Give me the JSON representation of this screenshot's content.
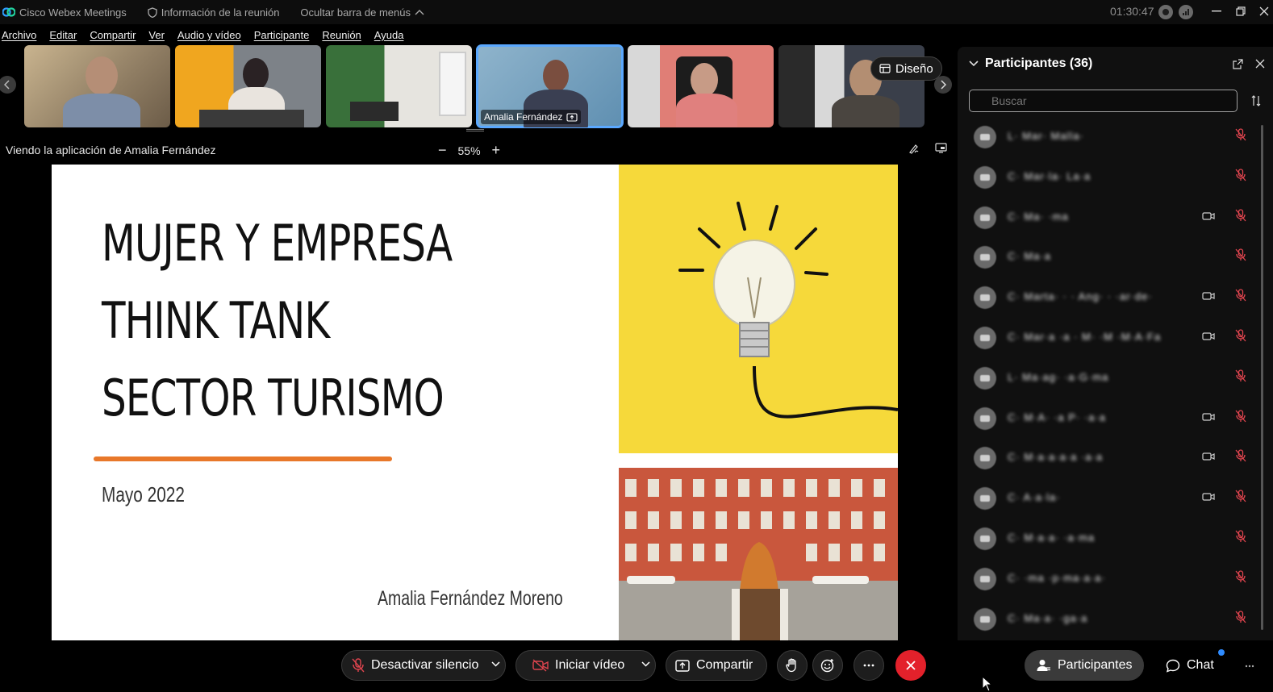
{
  "titlebar": {
    "app_name": "Cisco Webex Meetings",
    "meeting_info": "Información de la reunión",
    "hide_menu": "Ocultar barra de menús",
    "clock": "01:30:47"
  },
  "menu": [
    "Archivo",
    "Editar",
    "Compartir",
    "Ver",
    "Audio y vídeo",
    "Participante",
    "Reunión",
    "Ayuda"
  ],
  "strip": {
    "active_name": "Amalia Fernández",
    "layout_label": "Diseño"
  },
  "share": {
    "viewing": "Viendo la aplicación de Amalia Fernández",
    "zoom": "55%"
  },
  "slide": {
    "title_lines": [
      "MUJER Y EMPRESA",
      "THINK TANK",
      "SECTOR TURISMO"
    ],
    "date": "Mayo 2022",
    "author": "Amalia Fernández Moreno"
  },
  "panel": {
    "title": "Participantes (36)",
    "search_placeholder": "Buscar",
    "participants": [
      {
        "name": "L· Mar· Malla·",
        "video": false
      },
      {
        "name": "C· Mar·la· La·a",
        "video": false
      },
      {
        "name": "C· Ma· ·ma",
        "video": true
      },
      {
        "name": "C· Ma·a",
        "video": false
      },
      {
        "name": "C· Marta· · · Ang· · ·ar·de·",
        "video": true
      },
      {
        "name": "C· Mar·a ·a · M· ·M ·M·A·Fa",
        "video": true
      },
      {
        "name": "L· Ma·ag· ·a·G·ma",
        "video": false
      },
      {
        "name": "C· M·A· ·a P· ·a·a",
        "video": true
      },
      {
        "name": "C· M·a·a·a·a ·a·a",
        "video": true
      },
      {
        "name": "C· A·a·la·",
        "video": true
      },
      {
        "name": "C· M·a·a· ·a·ma",
        "video": false
      },
      {
        "name": "C· ·ma ·p·ma·a·a·",
        "video": false
      },
      {
        "name": "C· Ma·a· ·ga·a",
        "video": false
      }
    ]
  },
  "controls": {
    "unmute": "Desactivar silencio",
    "video": "Iniciar vídeo",
    "share": "Compartir",
    "participants": "Participantes",
    "chat": "Chat"
  },
  "colors": {
    "accent_blue": "#5aa8ff",
    "end_red": "#e3212b",
    "slide_yellow": "#f6d93a",
    "slide_orange": "#e8782a",
    "mic_muted": "#e0444e"
  }
}
